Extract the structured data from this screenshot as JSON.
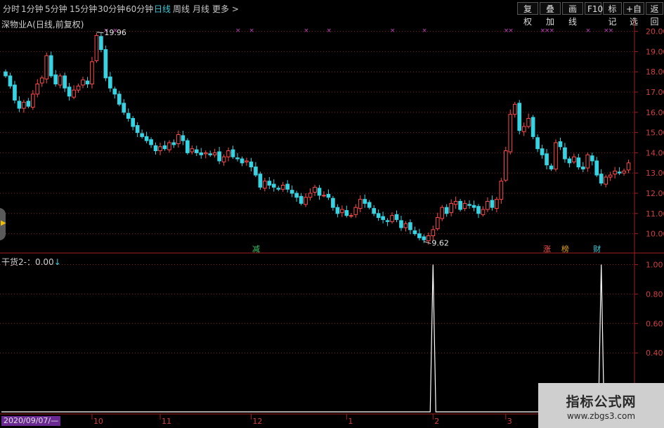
{
  "toolbar": {
    "periods": [
      "分时",
      "1分钟",
      "5分钟",
      "15分钟",
      "30分钟",
      "60分钟",
      "日线",
      "周线",
      "月线",
      "更多 >"
    ],
    "active_period": "日线",
    "buttons": [
      "复权",
      "叠加",
      "画线",
      "F10",
      "标记",
      "+自选",
      "返回"
    ]
  },
  "main_title": "深物业A(日线,前复权)",
  "indicator_title": "干货2-：0.00",
  "date_label": "2020/09/07/—",
  "watermark": {
    "line1": "指标公式网",
    "line2": "www.zbgs3.com"
  },
  "colors": {
    "up": "#ff4a4a",
    "down": "#36d3e3",
    "grid": "#8a1f1f",
    "axis": "#a02020",
    "indicator": "#ffffff",
    "marker": "#c040c0"
  },
  "chart_data": [
    {
      "type": "candlestick",
      "title": "深物业A(日线,前复权)",
      "ylim": [
        9.5,
        20.3
      ],
      "y_ticks": [
        "20.00",
        "19.00",
        "18.00",
        "17.00",
        "16.00",
        "15.00",
        "14.00",
        "13.00",
        "12.00",
        "11.00",
        "10.00"
      ],
      "x_ticks": [
        {
          "label": "10",
          "index": 19
        },
        {
          "label": "11",
          "index": 34
        },
        {
          "label": "12",
          "index": 54
        },
        {
          "label": "1",
          "index": 75
        },
        {
          "label": "2",
          "index": 94
        },
        {
          "label": "3",
          "index": 110
        }
      ],
      "closes": [
        17.8,
        17.3,
        16.6,
        16.2,
        16.5,
        16.3,
        16.9,
        17.4,
        17.7,
        18.8,
        17.8,
        17.4,
        17.8,
        17.2,
        16.8,
        17.1,
        17.3,
        17.6,
        17.4,
        18.5,
        19.8,
        19.1,
        17.7,
        17.2,
        16.9,
        16.4,
        16.0,
        15.7,
        15.3,
        15.0,
        14.8,
        14.6,
        14.4,
        14.1,
        14.3,
        14.2,
        14.5,
        14.4,
        14.9,
        14.6,
        14.0,
        14.2,
        14.0,
        13.9,
        14.0,
        13.9,
        14.0,
        13.6,
        13.8,
        14.1,
        13.8,
        13.7,
        13.5,
        13.6,
        13.3,
        12.9,
        12.3,
        12.6,
        12.4,
        12.3,
        12.2,
        12.4,
        12.2,
        12.0,
        11.8,
        11.5,
        11.8,
        12.0,
        12.3,
        11.9,
        11.9,
        11.8,
        11.3,
        11.0,
        11.2,
        10.9,
        10.9,
        11.3,
        11.7,
        11.5,
        11.3,
        11.0,
        10.8,
        10.7,
        10.6,
        10.9,
        10.7,
        10.3,
        10.5,
        10.2,
        10.0,
        9.8,
        9.7,
        9.9,
        10.2,
        10.8,
        11.3,
        11.0,
        11.5,
        11.6,
        11.2,
        11.5,
        11.4,
        11.3,
        11.0,
        11.2,
        11.6,
        11.3,
        11.7,
        12.6,
        14.1,
        15.9,
        16.4,
        15.1,
        15.3,
        15.7,
        14.8,
        14.2,
        13.9,
        13.4,
        13.2,
        14.5,
        14.3,
        13.7,
        13.5,
        13.8,
        13.3,
        13.2,
        13.9,
        13.6,
        12.9,
        12.5,
        12.8,
        12.9,
        13.1,
        13.0,
        13.1,
        13.5
      ],
      "ohlc_sample_note": "",
      "annotations": [
        {
          "text": "19.96",
          "index": 20,
          "price": 19.96
        },
        {
          "text": "9.62",
          "index": 92,
          "price": 9.62
        }
      ],
      "signal_markers": [
        {
          "text": "减",
          "index": 55,
          "color": "#3ec76a"
        },
        {
          "text": "涨",
          "index": 119,
          "color": "#ff5050"
        },
        {
          "text": "榜",
          "index": 123,
          "color": "#e0a020"
        },
        {
          "text": "财",
          "index": 130,
          "color": "#36d3e3"
        }
      ],
      "x_markers": [
        22,
        24,
        51,
        54,
        66,
        71,
        85,
        92,
        110,
        111,
        118,
        119,
        120,
        128,
        132,
        133
      ]
    },
    {
      "type": "line",
      "title": "干货2-：0.00",
      "ylim": [
        0,
        1.05
      ],
      "y_ticks": [
        "1.00",
        "0.80",
        "0.60",
        "0.40"
      ],
      "spikes": [
        94,
        131
      ],
      "count": 135,
      "values_note": "0 except 1.00 at spike indices"
    }
  ]
}
